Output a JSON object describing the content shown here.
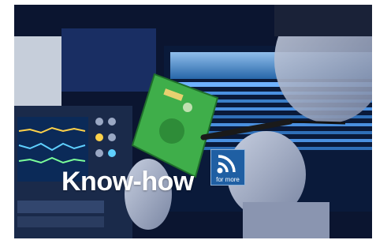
{
  "banner": {
    "headline": "Know-how",
    "more_label": "for more",
    "accent_color": "#1f5fa3"
  },
  "icons": {
    "signal": "wifi-signal-icon"
  }
}
